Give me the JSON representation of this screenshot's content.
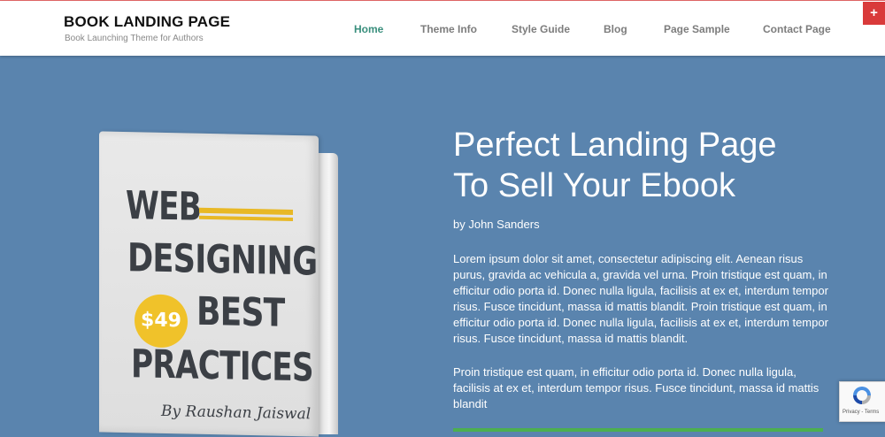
{
  "header": {
    "site_title": "BOOK LANDING PAGE",
    "site_description": "Book Launching Theme for Authors",
    "nav": [
      {
        "label": "Home",
        "active": true
      },
      {
        "label": "Theme Info",
        "active": false
      },
      {
        "label": "Style Guide",
        "active": false
      },
      {
        "label": "Blog",
        "active": false
      },
      {
        "label": "Page Sample",
        "active": false
      },
      {
        "label": "Contact Page",
        "active": false
      }
    ],
    "plus_label": "+"
  },
  "book": {
    "line1": "WEB",
    "line2": "DESIGNING",
    "line3": "BEST",
    "line4": "PRACTICES",
    "price": "$49",
    "author": "By Raushan Jaiswal"
  },
  "hero": {
    "heading_line1": "Perfect Landing Page",
    "heading_line2": "To Sell Your Ebook",
    "byline": "by John Sanders",
    "paragraph1": "Lorem ipsum dolor sit amet, consectetur adipiscing elit. Aenean risus purus, gravida ac vehicula a, gravida vel urna. Proin tristique est quam, in efficitur odio porta id. Donec nulla ligula, facilisis at ex et, interdum tempor risus. Fusce tincidunt, massa id mattis blandit. Proin tristique est quam, in efficitur odio porta id. Donec nulla ligula, facilisis at ex et, interdum tempor risus. Fusce tincidunt, massa id mattis blandit.",
    "paragraph2": "Proin tristique est quam, in efficitur odio porta id. Donec nulla ligula, facilisis at ex et, interdum tempor risus. Fusce tincidunt, massa id mattis blandit"
  },
  "recaptcha": {
    "footer": "Privacy - Terms"
  },
  "colors": {
    "hero_background": "#5a84ae",
    "nav_active": "#3a8f7d",
    "accent_red": "#d93a3a",
    "book_yellow": "#f0c22a"
  }
}
